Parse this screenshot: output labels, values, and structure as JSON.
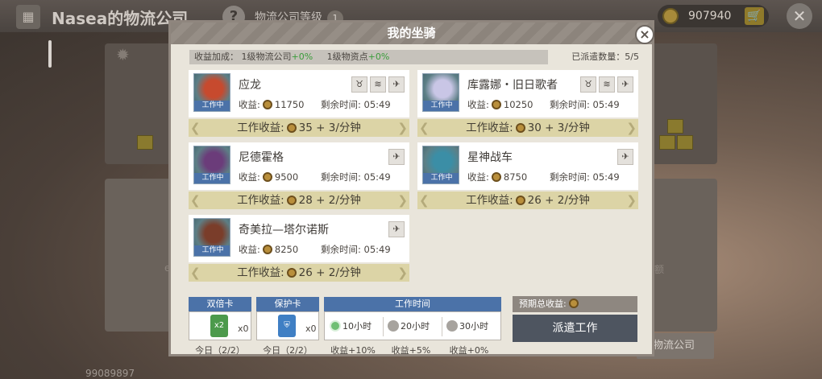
{
  "background": {
    "title": "Nasea的物流公司",
    "help": "?",
    "level_label": "物流公司等级",
    "level_value": "1",
    "coins": "907940",
    "player_id": "99089897",
    "right_button": "物流公司",
    "side_left": "e",
    "side_right": "额"
  },
  "modal": {
    "title": "我的坐骑",
    "close": "×",
    "bonus_prefix": "收益加成：",
    "bonus_company": "1级物流公司",
    "bonus_company_pct": "+0%",
    "bonus_point": "1级物资点",
    "bonus_point_pct": "+0%",
    "sent_count": "已派遣数量：5/5"
  },
  "mounts": [
    {
      "name": "应龙",
      "status": "工作中",
      "income_label": "收益:",
      "income": "11750",
      "remain_label": "剩余时间:",
      "remain": "05:49",
      "work_income": "工作收益:",
      "work_rate": "35 + 3/分钟",
      "tags": [
        "♉",
        "≋",
        "✈"
      ],
      "color": "#c74a2e"
    },
    {
      "name": "库露娜・旧日歌者",
      "status": "工作中",
      "income_label": "收益:",
      "income": "10250",
      "remain_label": "剩余时间:",
      "remain": "05:49",
      "work_income": "工作收益:",
      "work_rate": "30 + 3/分钟",
      "tags": [
        "♉",
        "≋",
        "✈"
      ],
      "color": "#c9c6e6"
    },
    {
      "name": "尼德霍格",
      "status": "工作中",
      "income_label": "收益:",
      "income": "9500",
      "remain_label": "剩余时间:",
      "remain": "05:49",
      "work_income": "工作收益:",
      "work_rate": "28 + 2/分钟",
      "tags": [
        "✈"
      ],
      "color": "#6b3c7a"
    },
    {
      "name": "星神战车",
      "status": "工作中",
      "income_label": "收益:",
      "income": "8750",
      "remain_label": "剩余时间:",
      "remain": "05:49",
      "work_income": "工作收益:",
      "work_rate": "26 + 2/分钟",
      "tags": [
        "✈"
      ],
      "color": "#3b8ea6"
    },
    {
      "name": "奇美拉—塔尔诺斯",
      "status": "工作中",
      "income_label": "收益:",
      "income": "8250",
      "remain_label": "剩余时间:",
      "remain": "05:49",
      "work_income": "工作收益:",
      "work_rate": "26 + 2/分钟",
      "tags": [
        "✈"
      ],
      "color": "#7a3d2a"
    }
  ],
  "cards": {
    "double": {
      "title": "双倍卡",
      "icon": "x2",
      "count": "x0",
      "today": "今日（2/2）"
    },
    "protect": {
      "title": "保护卡",
      "icon": "⛨",
      "count": "x0",
      "today": "今日（2/2）"
    }
  },
  "worktime": {
    "title": "工作时间",
    "options": [
      {
        "label": "10小时",
        "bonus": "收益+10%",
        "selected": true
      },
      {
        "label": "20小时",
        "bonus": "收益+5%",
        "selected": false
      },
      {
        "label": "30小时",
        "bonus": "收益+0%",
        "selected": false
      }
    ]
  },
  "expected_label": "预期总收益:",
  "dispatch_label": "派遣工作"
}
